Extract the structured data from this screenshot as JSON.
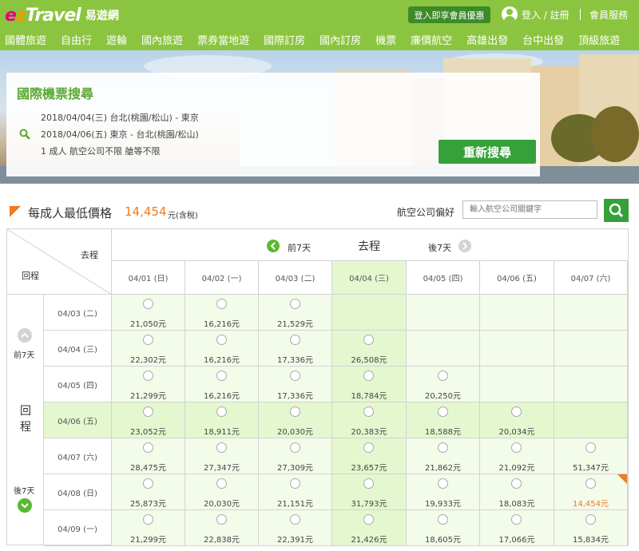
{
  "header": {
    "logo_text": "ezTravel",
    "logo_sub": "易遊網",
    "member_offer": "登入即享會員優惠",
    "login": "登入 / 註冊",
    "service": "會員服務"
  },
  "nav": [
    "國體旅遊",
    "自由行",
    "遊輪",
    "國內旅遊",
    "票券當地遊",
    "國際訂房",
    "國內訂房",
    "機票",
    "廉價航空",
    "高雄出發",
    "台中出發",
    "頂級旅遊"
  ],
  "search_panel": {
    "title": "國際機票搜尋",
    "line1": "2018/04/04(三)   台北(桃園/松山) - 東京",
    "line2": "2018/04/06(五)   東京 - 台北(桃園/松山)",
    "line3": "1 成人     航空公司不限     艙等不限",
    "research_button": "重新搜尋"
  },
  "price_bar": {
    "label": "每成人最低價格",
    "price": "14,454",
    "unit": "元(含稅)",
    "airline_label": "航空公司偏好",
    "airline_placeholder": "輸入航空公司關鍵字"
  },
  "table": {
    "corner_depart": "去程",
    "corner_return": "回程",
    "prev7": "前7天",
    "depart": "去程",
    "next7": "後7天",
    "side_prev7": "前7天",
    "side_return": "回程",
    "side_next7": "後7天",
    "columns": [
      "04/01 (日)",
      "04/02 (一)",
      "04/03 (二)",
      "04/04 (三)",
      "04/05 (四)",
      "04/06 (五)",
      "04/07 (六)"
    ],
    "rows": [
      {
        "date": "04/03 (二)",
        "cells": [
          "21,050元",
          "16,216元",
          "21,529元",
          "",
          "",
          "",
          ""
        ]
      },
      {
        "date": "04/04 (三)",
        "cells": [
          "22,302元",
          "16,216元",
          "17,336元",
          "26,508元",
          "",
          "",
          ""
        ]
      },
      {
        "date": "04/05 (四)",
        "cells": [
          "21,299元",
          "16,216元",
          "17,336元",
          "18,784元",
          "20,250元",
          "",
          ""
        ]
      },
      {
        "date": "04/06 (五)",
        "cells": [
          "23,052元",
          "18,911元",
          "20,030元",
          "20,383元",
          "18,588元",
          "20,034元",
          ""
        ]
      },
      {
        "date": "04/07 (六)",
        "cells": [
          "28,475元",
          "27,347元",
          "27,309元",
          "23,657元",
          "21,862元",
          "21,092元",
          "51,347元"
        ]
      },
      {
        "date": "04/08 (日)",
        "cells": [
          "25,873元",
          "20,030元",
          "21,151元",
          "31,793元",
          "19,933元",
          "18,083元",
          "14,454元"
        ]
      },
      {
        "date": "04/09 (一)",
        "cells": [
          "21,299元",
          "22,838元",
          "22,391元",
          "21,426元",
          "18,605元",
          "17,066元",
          "15,834元"
        ]
      }
    ],
    "selected_column": 3,
    "selected_row": 3,
    "lowest": {
      "row": 5,
      "col": 6
    }
  },
  "colors": {
    "brand_green": "#8bc53f",
    "button_green": "#36a03a",
    "accent_orange": "#f07a20",
    "cell_bg": "#f3fbe9",
    "highlight_bg": "#e4f7cf"
  }
}
